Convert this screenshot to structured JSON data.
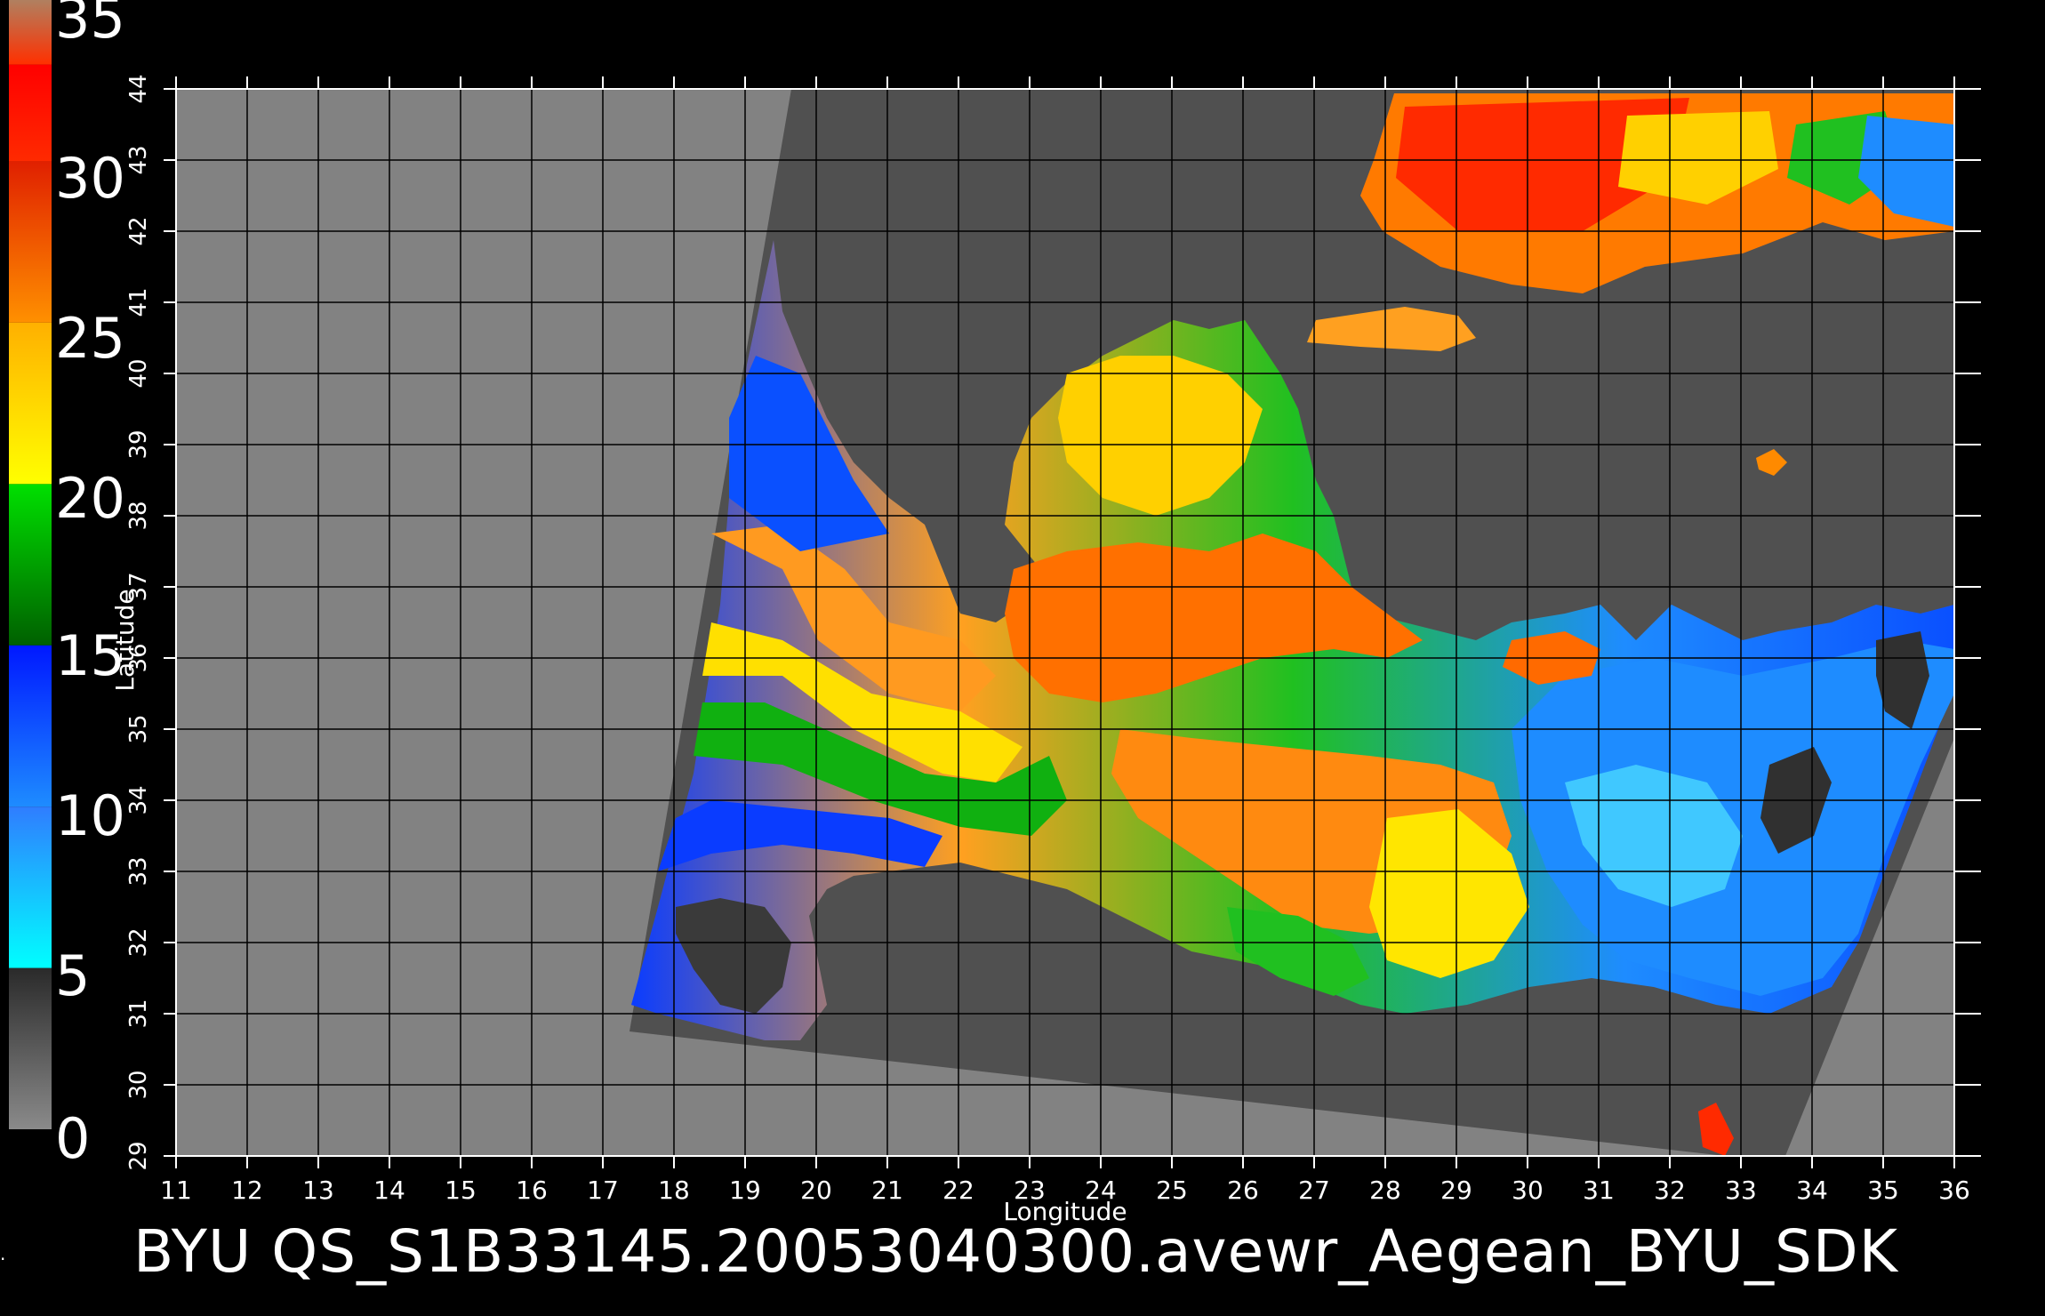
{
  "colorbar": {
    "labels": [
      "35",
      "30",
      "25",
      "20",
      "15",
      "10",
      "5",
      "0"
    ],
    "segments": [
      {
        "from": 0,
        "to": 5,
        "color_top": "#2a2a2a",
        "color_bottom": "#8a8a8a"
      },
      {
        "from": 5,
        "to": 10,
        "color_top": "#2f7dff",
        "color_bottom": "#00ffff"
      },
      {
        "from": 10,
        "to": 15,
        "color_top": "#0018ff",
        "color_bottom": "#1e8cff"
      },
      {
        "from": 15,
        "to": 20,
        "color_top": "#00e000",
        "color_bottom": "#006000"
      },
      {
        "from": 20,
        "to": 25,
        "color_top": "#ffb000",
        "color_bottom": "#ffff00"
      },
      {
        "from": 25,
        "to": 30,
        "color_top": "#e02000",
        "color_bottom": "#ff9000"
      },
      {
        "from": 30,
        "to": 33,
        "color_top": "#ff0000",
        "color_bottom": "#ff2a00"
      },
      {
        "from": 33,
        "to": 35,
        "color_top": "#b08060",
        "color_bottom": "#ff3000"
      }
    ]
  },
  "map": {
    "xlabel": "Longitude",
    "ylabel": "Latitude",
    "lon_ticks": [
      "11",
      "12",
      "13",
      "14",
      "15",
      "16",
      "17",
      "18",
      "19",
      "20",
      "21",
      "22",
      "23",
      "24",
      "25",
      "26",
      "27",
      "28",
      "29",
      "30",
      "31",
      "32",
      "33",
      "34",
      "35",
      "36"
    ],
    "lat_ticks": [
      "29",
      "30",
      "31",
      "32",
      "33",
      "34",
      "35",
      "36",
      "37",
      "38",
      "39",
      "40",
      "41",
      "42",
      "43",
      "44"
    ],
    "lon_range": [
      11,
      36
    ],
    "lat_range": [
      29,
      44
    ],
    "colors": {
      "no_data": "#828282",
      "land": "#505050",
      "grid": "#000000"
    }
  },
  "footer": {
    "title": "BYU  QS_S1B33145.20053040300.avewr_Aegean_BYU_SDK",
    "left_mark": "."
  }
}
